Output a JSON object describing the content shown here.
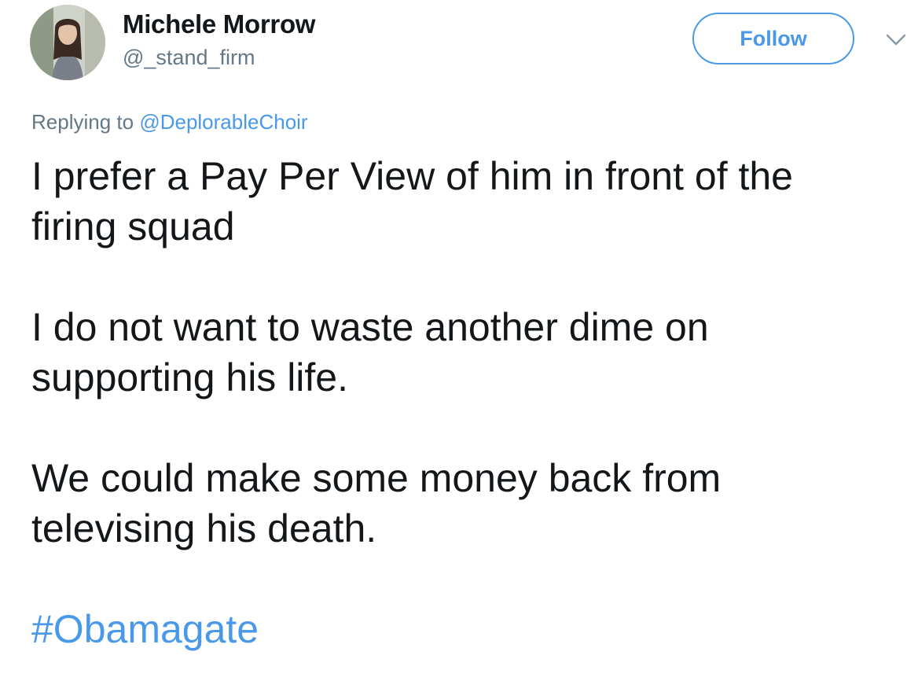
{
  "author": {
    "display_name": "Michele Morrow",
    "handle": "@_stand_firm",
    "avatar_icon": "profile-photo"
  },
  "actions": {
    "follow_label": "Follow",
    "menu_icon": "chevron-down-icon"
  },
  "reply": {
    "prefix": "Replying to",
    "mention": "@DeplorableChoir"
  },
  "tweet": {
    "paragraphs": [
      "I prefer a Pay Per View of him in front of the firing squad",
      "I do not want to waste another dime on supporting his life.",
      "We could make some money back from televising his death."
    ],
    "hashtag": "#Obamagate"
  },
  "colors": {
    "link": "#4a99e9",
    "secondary_text": "#657786",
    "primary_text": "#14171a"
  }
}
